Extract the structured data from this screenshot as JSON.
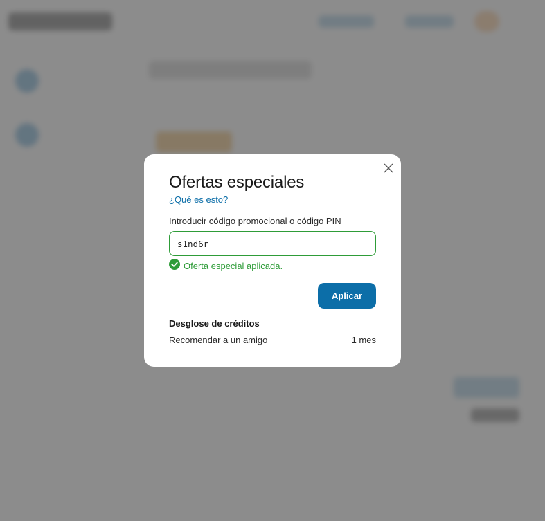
{
  "modal": {
    "title": "Ofertas especiales",
    "help_link": "¿Qué es esto?",
    "field_label": "Introducir código promocional o código PIN",
    "promo_code_value": "s1nd6r",
    "success_message": "Oferta especial aplicada.",
    "apply_label": "Aplicar",
    "breakdown_title": "Desglose de créditos",
    "credits": [
      {
        "label": "Recomendar a un amigo",
        "value": "1 mes"
      }
    ]
  },
  "colors": {
    "accent": "#0c6ea8",
    "success": "#2e9c38",
    "overlay": "rgba(110,110,110,0.78)"
  },
  "icons": {
    "close": "close-icon",
    "success": "check-circle-icon"
  }
}
